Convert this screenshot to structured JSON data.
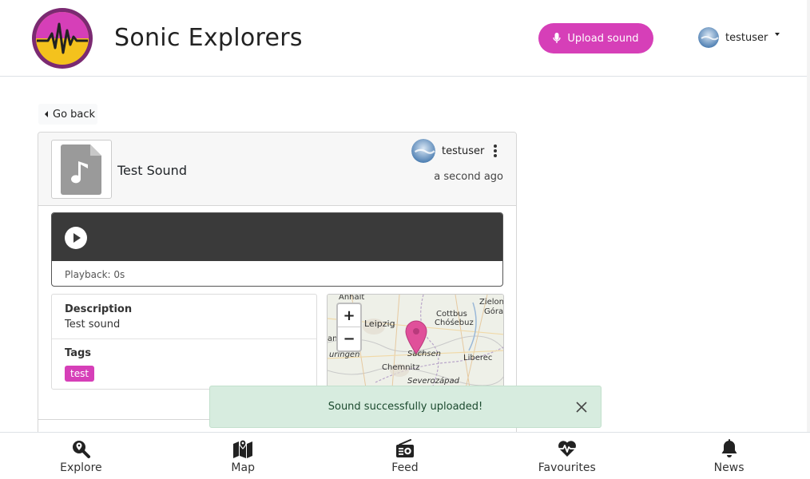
{
  "header": {
    "brand": "Sonic Explorers",
    "upload_label": "Upload sound",
    "username": "testuser",
    "accent": "#d63fb8"
  },
  "nav": {
    "go_back": "Go back"
  },
  "sound": {
    "title": "Test Sound",
    "author": "testuser",
    "timestamp": "a second ago",
    "playback_label": "Playback: 0s",
    "description_label": "Description",
    "description": "Test sound",
    "tags_label": "Tags",
    "tags": [
      "test"
    ]
  },
  "map": {
    "zoom_in": "+",
    "zoom_out": "−",
    "labels": [
      "Anhalt",
      "Zielon",
      "Góra",
      "Cottbus",
      "Chóśebuz",
      "Leipzig",
      "Sachsen",
      "Liberec",
      "Chemnitz",
      "Severozápad",
      "uringen",
      "an"
    ]
  },
  "toast": {
    "message": "Sound successfully uploaded!"
  },
  "bottom_nav": [
    {
      "label": "Explore",
      "icon": "search-location-icon"
    },
    {
      "label": "Map",
      "icon": "map-icon"
    },
    {
      "label": "Feed",
      "icon": "radio-icon"
    },
    {
      "label": "Favourites",
      "icon": "heartbeat-icon"
    },
    {
      "label": "News",
      "icon": "bell-icon"
    }
  ]
}
